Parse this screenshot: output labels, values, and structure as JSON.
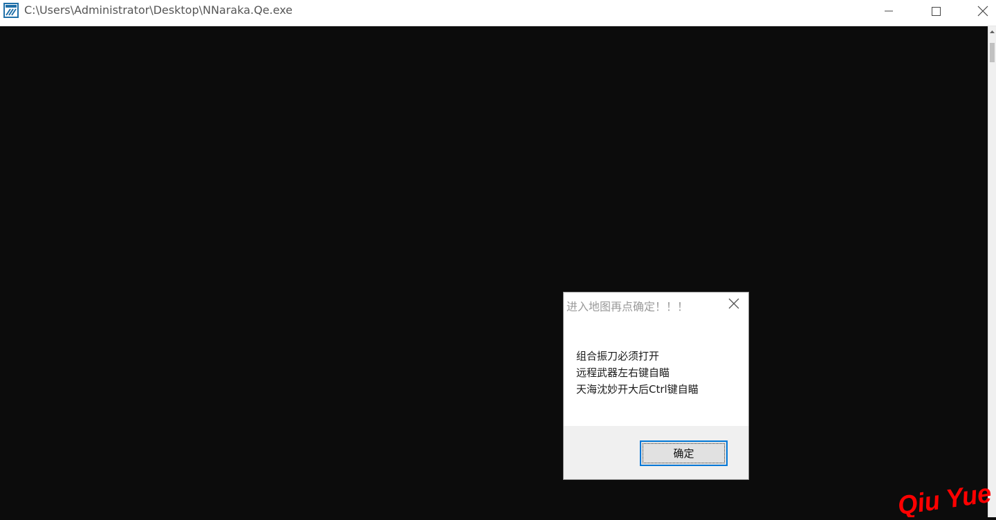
{
  "window": {
    "title": "C:\\Users\\Administrator\\Desktop\\NNaraka.Qe.exe",
    "icon": "console-app-icon",
    "controls": [
      "minimize-icon",
      "maximize-icon",
      "close-icon"
    ]
  },
  "dialog": {
    "title": "进入地图再点确定！！！",
    "lines": [
      "组合振刀必须打开",
      "远程武器左右键自瞄",
      "天海沈妙开大后Ctrl键自瞄"
    ],
    "ok_label": "确定",
    "close_icon": "close-icon"
  },
  "watermark": {
    "text": "Qiu Yue",
    "color": "#ff0000"
  },
  "colors": {
    "console_bg": "#0c0c0c",
    "accent": "#0078d7"
  }
}
